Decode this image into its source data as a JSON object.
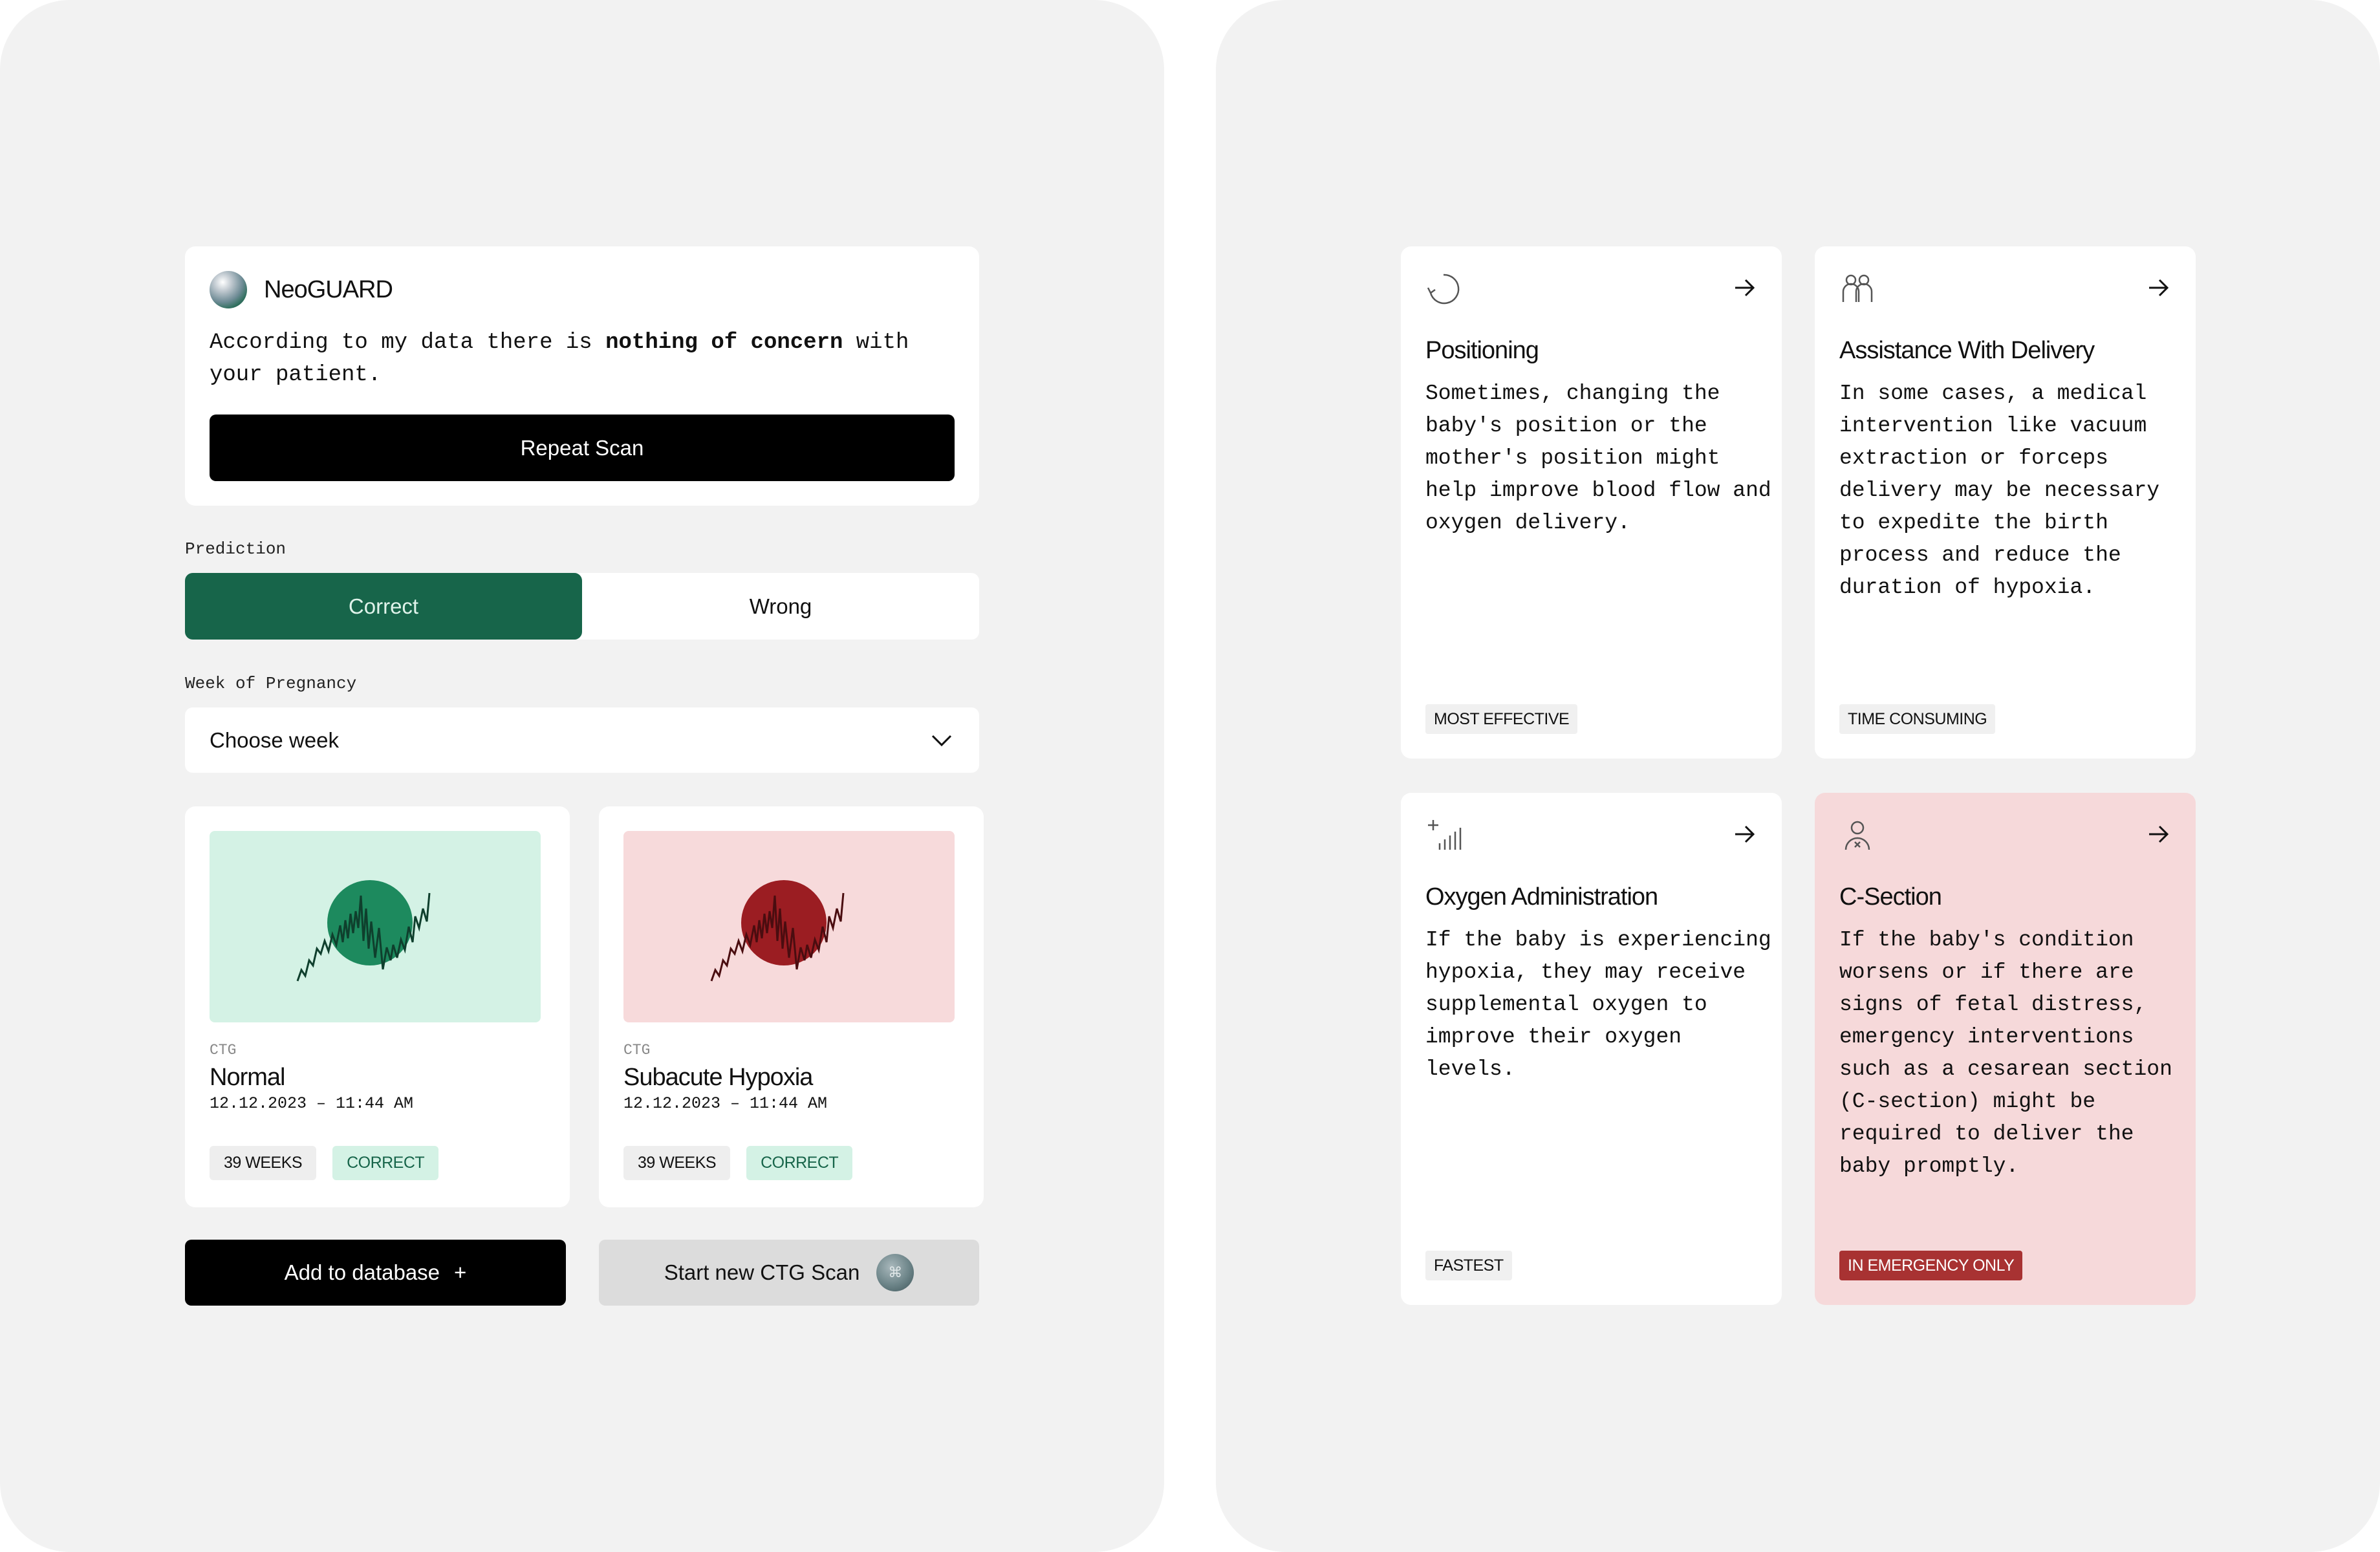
{
  "assistant": {
    "name": "NeoGUARD",
    "message_before": "According to my data there is ",
    "message_bold": "nothing of concern",
    "message_after": " with your patient.",
    "repeat_button": "Repeat Scan"
  },
  "prediction": {
    "label": "Prediction",
    "options": [
      "Correct",
      "Wrong"
    ],
    "selected": "Correct"
  },
  "week": {
    "label": "Week of Pregnancy",
    "placeholder": "Choose week"
  },
  "ctg_cards": [
    {
      "category": "CTG",
      "title": "Normal",
      "date": "12.12.2023 – 11:44 AM",
      "tags": [
        "39 WEEKS",
        "CORRECT"
      ]
    },
    {
      "category": "CTG",
      "title": "Subacute Hypoxia",
      "date": "12.12.2023 – 11:44 AM",
      "tags": [
        "39 WEEKS",
        "CORRECT"
      ]
    }
  ],
  "actions": {
    "add_label": "Add to database",
    "add_icon": "+",
    "scan_label": "Start new CTG Scan"
  },
  "treatments": [
    {
      "icon": "refresh-icon",
      "title": "Positioning",
      "description": "Sometimes, changing the baby's position or the mother's position might help improve blood flow and oxygen delivery.",
      "badge": "MOST EFFECTIVE"
    },
    {
      "icon": "people-icon",
      "title": "Assistance With Delivery",
      "description": "In some cases, a medical intervention like vacuum extraction or forceps delivery may be necessary to expedite the birth process and reduce the duration of hypoxia.",
      "badge": "TIME CONSUMING"
    },
    {
      "icon": "oxygen-icon",
      "title": "Oxygen Administration",
      "description": "If the baby is experiencing hypoxia, they may receive supplemental oxygen to improve their oxygen levels.",
      "badge": "FASTEST"
    },
    {
      "icon": "surgeon-icon",
      "title": "C-Section",
      "description": "If the baby's condition worsens or if there are signs of fetal distress, emergency interventions such as a cesarean section (C-section) might be required to deliver the baby promptly.",
      "badge": "IN EMERGENCY ONLY"
    }
  ],
  "colors": {
    "accent_green": "#17654a",
    "mint": "#d4f2e5",
    "pink": "#f6d9da",
    "danger": "#a83232"
  }
}
